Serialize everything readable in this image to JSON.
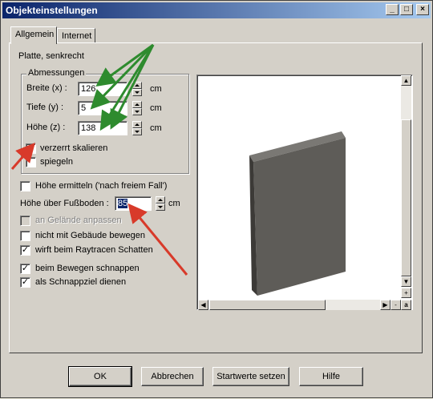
{
  "window": {
    "title": "Objekteinstellungen",
    "controls": {
      "minimize": "_",
      "maximize": "□",
      "close": "×"
    }
  },
  "tabs": [
    {
      "label": "Allgemein",
      "active": true
    },
    {
      "label": "Internet",
      "active": false
    }
  ],
  "object_type": "Platte, senkrecht",
  "dimensions": {
    "legend": "Abmessungen",
    "fields": [
      {
        "label": "Breite (x) :",
        "value": "126",
        "unit": "cm"
      },
      {
        "label": "Tiefe (y) :",
        "value": "5",
        "unit": "cm"
      },
      {
        "label": "Höhe (z) :",
        "value": "138",
        "unit": "cm"
      }
    ],
    "checkboxes": [
      {
        "label": "verzerrt skalieren",
        "checked": true
      },
      {
        "label": "spiegeln",
        "checked": false
      }
    ]
  },
  "options": {
    "height_detect": {
      "label": "Höhe ermitteln ('nach freiem Fall')",
      "checked": false
    },
    "floor_height": {
      "label": "Höhe über Fußboden :",
      "value": "85",
      "unit": "cm"
    },
    "terrain": {
      "label": "an Gelände anpassen",
      "checked": false,
      "enabled": false
    },
    "not_move_with_building": {
      "label": "nicht mit Gebäude bewegen",
      "checked": false
    },
    "raytrace_shadow": {
      "label": "wirft beim Raytracen Schatten",
      "checked": true
    },
    "snap_on_move": {
      "label": "beim Bewegen schnappen",
      "checked": true
    },
    "snap_target": {
      "label": "als Schnappziel dienen",
      "checked": true
    }
  },
  "preview": {
    "zoom_in": "+",
    "zoom_out": "-",
    "zoom_auto": "a",
    "panel_color": "#5e5c58"
  },
  "buttons": {
    "ok": "OK",
    "cancel": "Abbrechen",
    "reset": "Startwerte setzen",
    "help": "Hilfe"
  },
  "colors": {
    "annotation_green": "#2e8b2e",
    "annotation_red": "#d83a2a",
    "title_active": "#0a246a"
  }
}
